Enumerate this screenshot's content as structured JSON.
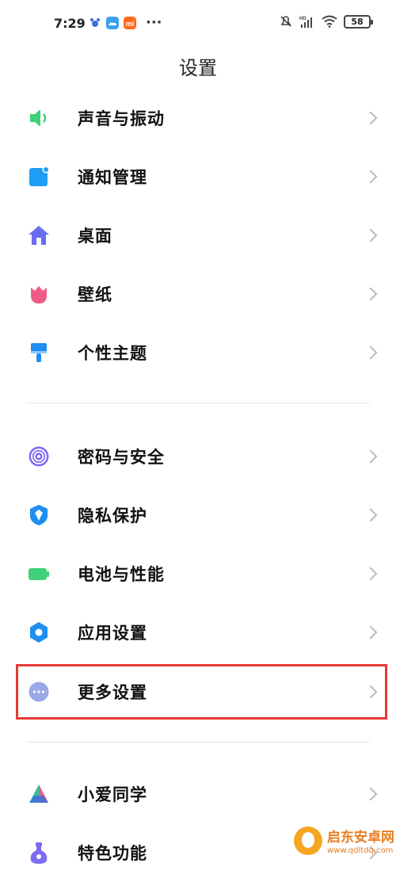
{
  "status_bar": {
    "time": "7:29",
    "battery": "58",
    "dots": "···"
  },
  "page": {
    "title": "设置"
  },
  "settings_items": [
    {
      "label": "声音与振动",
      "icon": "speaker-icon",
      "color": "#3fd07a"
    },
    {
      "label": "通知管理",
      "icon": "notification-icon",
      "color": "#1e9ef4"
    },
    {
      "label": "桌面",
      "icon": "home-icon",
      "color": "#6b6df0"
    },
    {
      "label": "壁纸",
      "icon": "tulip-icon",
      "color": "#ef5b86"
    },
    {
      "label": "个性主题",
      "icon": "brush-icon",
      "color": "#1e8ef0"
    },
    {
      "label": "密码与安全",
      "icon": "fingerprint-icon",
      "color": "#7e6bf3"
    },
    {
      "label": "隐私保护",
      "icon": "shield-icon",
      "color": "#1e8ef0"
    },
    {
      "label": "电池与性能",
      "icon": "battery-icon",
      "color": "#3fd07a"
    },
    {
      "label": "应用设置",
      "icon": "gear-icon",
      "color": "#1e8ef0"
    },
    {
      "label": "更多设置",
      "icon": "more-icon",
      "color": "#9aa8e6"
    },
    {
      "label": "小爱同学",
      "icon": "xiaoai-icon",
      "color": "#2ec4a0"
    },
    {
      "label": "特色功能",
      "icon": "flask-icon",
      "color": "#7e6bf3"
    }
  ],
  "watermark": {
    "title": "启东安卓网",
    "url": "www.qdltdq.com"
  }
}
